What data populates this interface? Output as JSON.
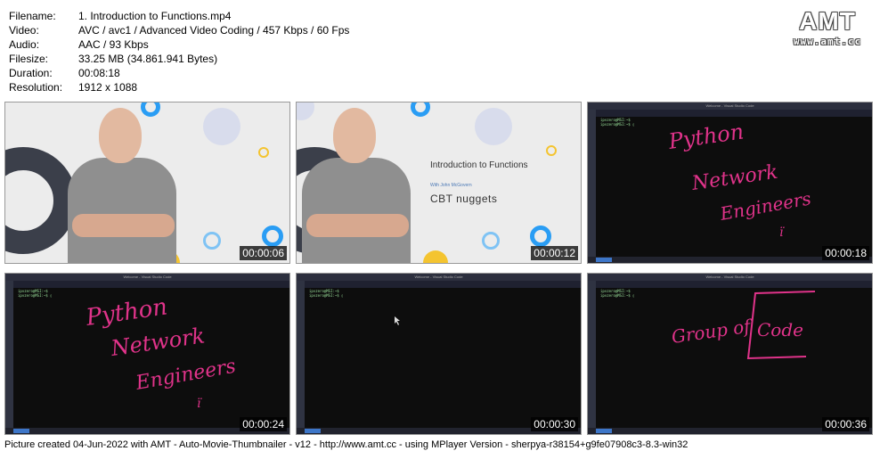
{
  "info": {
    "filename_key": "Filename:",
    "filename": "1. Introduction to Functions.mp4",
    "video_key": "Video:",
    "video": "AVC / avc1 / Advanced Video Coding / 457 Kbps / 60 Fps",
    "audio_key": "Audio:",
    "audio": "AAC / 93 Kbps",
    "filesize_key": "Filesize:",
    "filesize": "33.25 MB (34.861.941 Bytes)",
    "duration_key": "Duration:",
    "duration": "00:08:18",
    "resolution_key": "Resolution:",
    "resolution": "1912 x 1088"
  },
  "logo": {
    "name": "AMT",
    "url": "www.amt.cc"
  },
  "thumbs": [
    {
      "timestamp": "00:00:06"
    },
    {
      "timestamp": "00:00:12",
      "title": "Introduction to Functions",
      "subtitle": "With John McGovern",
      "brand": "CBT nuggets"
    },
    {
      "timestamp": "00:00:18",
      "handwriting": "Python Network Engineers"
    },
    {
      "timestamp": "00:00:24",
      "handwriting": "Python Network Engineers"
    },
    {
      "timestamp": "00:00:30"
    },
    {
      "timestamp": "00:00:36",
      "handwriting": "Group of Code"
    }
  ],
  "terminal": {
    "line1": "ipvzero@MSI:~$",
    "line2": "ipvzero@MSI:~$ ▯",
    "window_title": "Welcome - Visual Studio Code"
  },
  "footer": "Picture created 04-Jun-2022 with AMT - Auto-Movie-Thumbnailer - v12 - http://www.amt.cc - using MPlayer Version - sherpya-r38154+g9fe07908c3-8.3-win32",
  "colors": {
    "ink": "#e0338a",
    "terminal_green": "#9be29b",
    "slide_blue": "#2a9df4",
    "slide_yellow": "#f4c430"
  }
}
